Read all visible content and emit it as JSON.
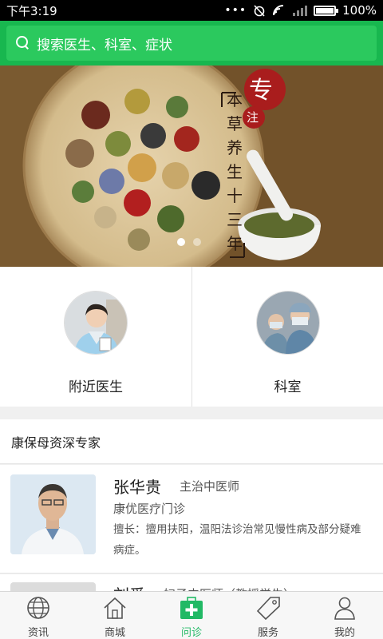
{
  "status_bar": {
    "time": "下午3:19",
    "battery": "100%",
    "battery_level": 1.0
  },
  "search": {
    "placeholder": "搜索医生、科室、症状"
  },
  "banner": {
    "seal_big": "专",
    "seal_small": "注",
    "vertical_text": [
      "本",
      "草",
      "养",
      "生",
      "十",
      "三",
      "年"
    ],
    "active_slide": 0,
    "slides": 3
  },
  "quick_entries": [
    {
      "label": "附近医生",
      "icon": "doctor-avatar"
    },
    {
      "label": "科室",
      "icon": "department-avatar"
    }
  ],
  "section": {
    "title": "康保母资深专家"
  },
  "doctors": [
    {
      "name": "张华贵",
      "title": "主治中医师",
      "hospital": "康优医疗门诊",
      "desc": "擅长：擅用扶阳，温阳法诊治常见慢性病及部分疑难病症。"
    },
    {
      "name": "刘爱",
      "title": "妇子中医师（教授学生）"
    }
  ],
  "tabs": [
    {
      "label": "资讯",
      "icon": "globe-icon"
    },
    {
      "label": "商城",
      "icon": "home-icon"
    },
    {
      "label": "问诊",
      "icon": "medical-kit-icon",
      "active": true
    },
    {
      "label": "服务",
      "icon": "tag-icon"
    },
    {
      "label": "我的",
      "icon": "person-icon"
    }
  ],
  "colors": {
    "brand": "#18b74f",
    "active_tab": "#22b965"
  }
}
